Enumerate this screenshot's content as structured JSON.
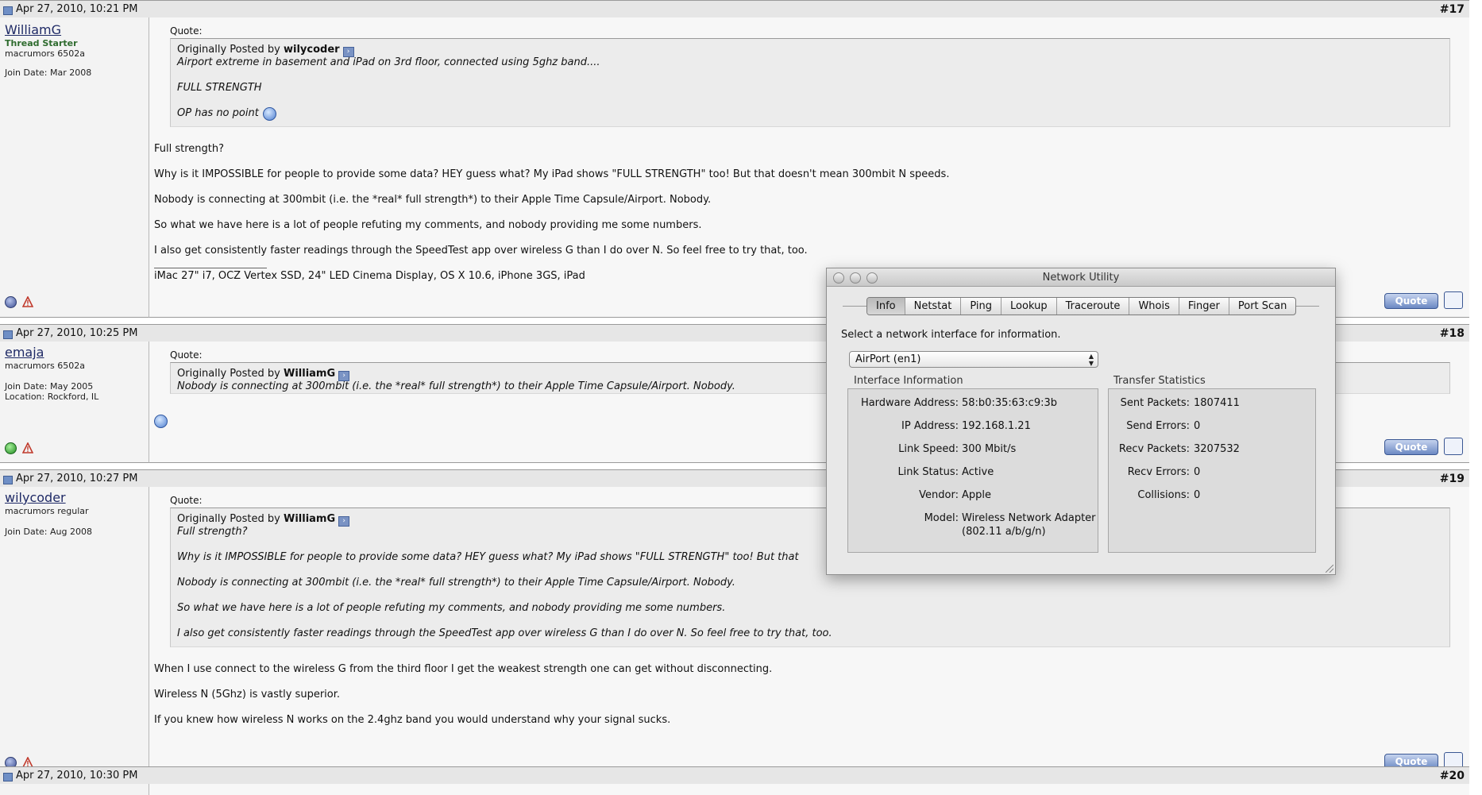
{
  "posts": [
    {
      "date": "Apr 27, 2010, 10:21 PM",
      "number": "#17",
      "username": "WilliamG",
      "user_status": "Thread Starter",
      "rank": "macrumors 6502a",
      "join_date": "Join Date: Mar 2008",
      "location": "",
      "quote_label": "Quote:",
      "quote_by_prefix": "Originally Posted by",
      "quote_author": "wilycoder",
      "quote_lines": [
        "Airport extreme in basement and iPad on 3rd floor, connected using 5ghz band....",
        "FULL STRENGTH",
        "OP has no point"
      ],
      "body_lines": [
        "Full strength?",
        "Why is it IMPOSSIBLE for people to provide some data? HEY guess what? My iPad shows \"FULL STRENGTH\" too! But that doesn't mean 300mbit N speeds.",
        "Nobody is connecting at 300mbit (i.e. the *real* full strength*) to their Apple Time Capsule/Airport. Nobody.",
        "So what we have here is a lot of people refuting my comments, and nobody providing me some numbers.",
        "I also get consistently faster readings through the SpeedTest app over wireless G than I do over N. So feel free to try that, too."
      ],
      "signature": "iMac 27\" i7, OCZ Vertex SSD, 24\" LED Cinema Display, OS X 10.6, iPhone 3GS, iPad",
      "quote_button": "Quote",
      "online": false
    },
    {
      "date": "Apr 27, 2010, 10:25 PM",
      "number": "#18",
      "username": "emaja",
      "rank": "macrumors 6502a",
      "join_date": "Join Date: May 2005",
      "location": "Location: Rockford, IL",
      "quote_label": "Quote:",
      "quote_by_prefix": "Originally Posted by",
      "quote_author": "WilliamG",
      "quote_lines": [
        "Nobody is connecting at 300mbit (i.e. the *real* full strength*) to their Apple Time Capsule/Airport. Nobody."
      ],
      "quote_button": "Quote",
      "online": true
    },
    {
      "date": "Apr 27, 2010, 10:27 PM",
      "number": "#19",
      "username": "wilycoder",
      "rank": "macrumors regular",
      "join_date": "Join Date: Aug 2008",
      "quote_label": "Quote:",
      "quote_by_prefix": "Originally Posted by",
      "quote_author": "WilliamG",
      "quote_lines": [
        "Full strength?",
        "Why is it IMPOSSIBLE for people to provide some data? HEY guess what? My iPad shows \"FULL STRENGTH\" too! But that",
        "Nobody is connecting at 300mbit (i.e. the *real* full strength*) to their Apple Time Capsule/Airport. Nobody.",
        "So what we have here is a lot of people refuting my comments, and nobody providing me some numbers.",
        "I also get consistently faster readings through the SpeedTest app over wireless G than I do over N. So feel free to try that, too."
      ],
      "body_lines": [
        "When I use connect to the wireless G from the third floor I get the weakest strength one can get without disconnecting.",
        "Wireless N (5Ghz) is vastly superior.",
        "If you knew how wireless N works on the 2.4ghz band you would understand why your signal sucks."
      ],
      "quote_button": "Quote",
      "online": false
    },
    {
      "date": "Apr 27, 2010, 10:30 PM",
      "number": "#20"
    }
  ],
  "network_utility": {
    "title": "Network Utility",
    "tabs": [
      "Info",
      "Netstat",
      "Ping",
      "Lookup",
      "Traceroute",
      "Whois",
      "Finger",
      "Port Scan"
    ],
    "active_tab": "Info",
    "prompt": "Select a network interface for information.",
    "interface_selected": "AirPort (en1)",
    "interface_info_label": "Interface Information",
    "transfer_stats_label": "Transfer Statistics",
    "interface_info": [
      {
        "k": "Hardware Address:",
        "v": "58:b0:35:63:c9:3b"
      },
      {
        "k": "IP Address:",
        "v": "192.168.1.21"
      },
      {
        "k": "Link Speed:",
        "v": "300 Mbit/s"
      },
      {
        "k": "Link Status:",
        "v": "Active"
      },
      {
        "k": "Vendor:",
        "v": "Apple"
      },
      {
        "k": "Model:",
        "v": "Wireless Network Adapter",
        "v2": "(802.11 a/b/g/n)"
      }
    ],
    "transfer_stats": [
      {
        "k": "Sent Packets:",
        "v": "1807411"
      },
      {
        "k": "Send Errors:",
        "v": "0"
      },
      {
        "k": "Recv Packets:",
        "v": "3207532"
      },
      {
        "k": "Recv Errors:",
        "v": "0"
      },
      {
        "k": "Collisions:",
        "v": "0"
      }
    ]
  }
}
